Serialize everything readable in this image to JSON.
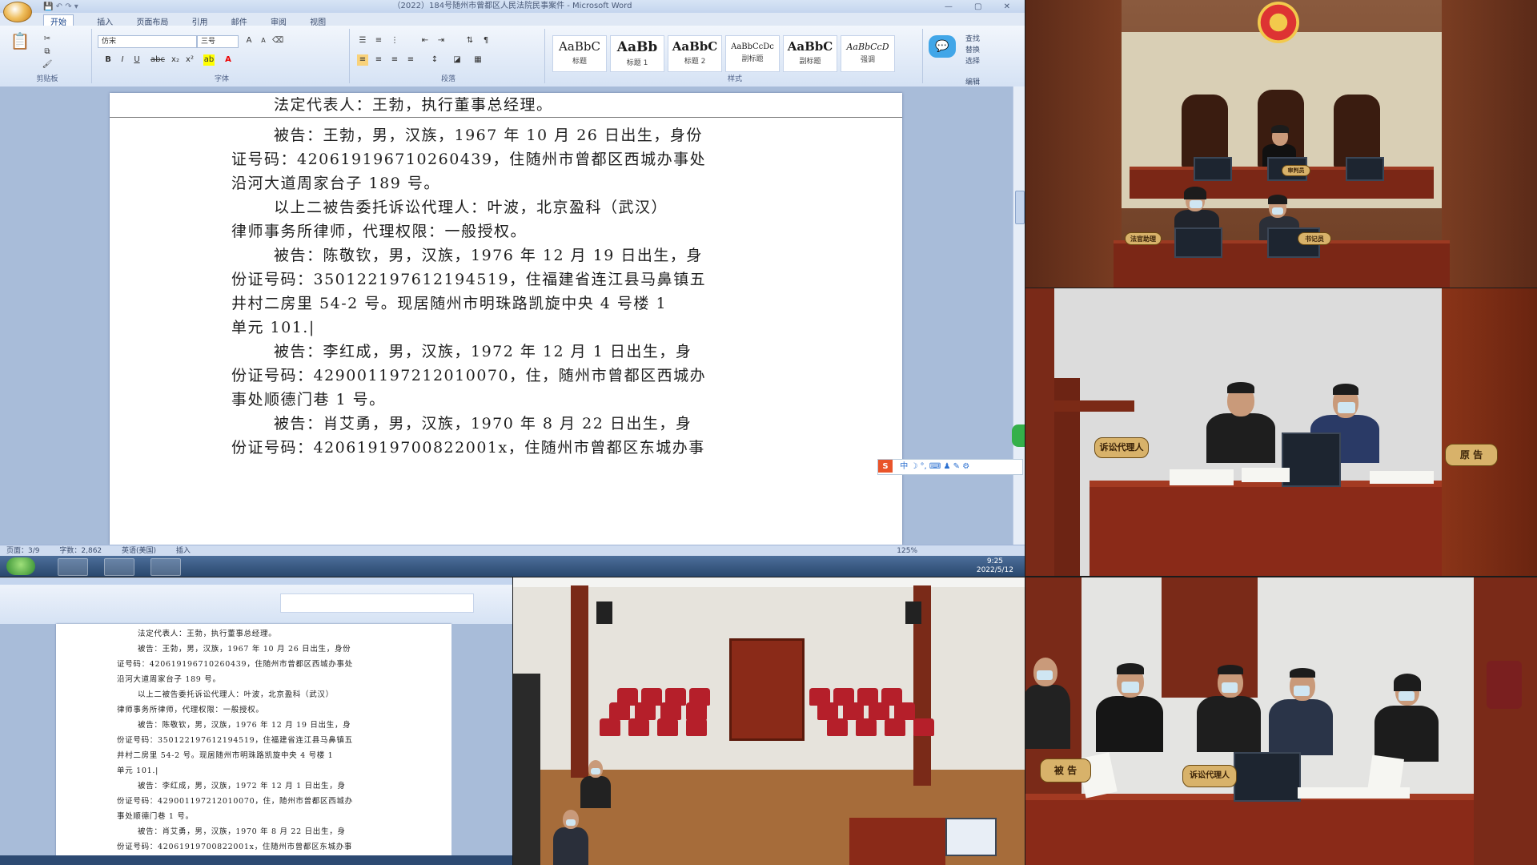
{
  "word": {
    "title_bar": "（2022）184号随州市曾都区人民法院民事案件    - Microsoft Word",
    "tabs": [
      "开始",
      "插入",
      "页面布局",
      "引用",
      "邮件",
      "审阅",
      "视图"
    ],
    "font_name": "仿宋",
    "font_size": "三号",
    "styles": [
      {
        "sample": "AaBbC",
        "name": "标题"
      },
      {
        "sample": "AaBb",
        "name": "标题 1"
      },
      {
        "sample": "AaBbC",
        "name": "标题 2"
      },
      {
        "sample": "AaBbCcDc",
        "name": "副标题"
      },
      {
        "sample": "AaBbC",
        "name": "副标题"
      },
      {
        "sample": "AaBbCcD",
        "name": "强调"
      }
    ],
    "group_labels": [
      "剪贴板",
      "字体",
      "段落",
      "样式",
      "编辑"
    ],
    "edit_group": [
      "查找",
      "替换",
      "选择"
    ],
    "doc_lines": [
      {
        "text": "法定代表人：王勃，执行董事总经理。",
        "indent": true
      },
      {
        "text": "被告：王勃，男，汉族，1967 年 10 月 26 日出生，身份",
        "indent": true
      },
      {
        "text": "证号码：420619196710260439，住随州市曾都区西城办事处",
        "indent": false
      },
      {
        "text": "沿河大道周家台子 189 号。",
        "indent": false
      },
      {
        "text": "以上二被告委托诉讼代理人：叶波，北京盈科（武汉）",
        "indent": true
      },
      {
        "text": "律师事务所律师，代理权限：一般授权。",
        "indent": false
      },
      {
        "text": "被告：陈敬钦，男，汉族，1976 年 12 月 19 日出生，身",
        "indent": true
      },
      {
        "text": "份证号码：350122197612194519，住福建省连江县马鼻镇五",
        "indent": false
      },
      {
        "text": "井村二房里 54-2 号。现居随州市明珠路凯旋中央 4 号楼 1",
        "indent": false
      },
      {
        "text": "单元 101.|",
        "indent": false
      },
      {
        "text": "被告：李红成，男，汉族，1972 年 12 月 1 日出生，身",
        "indent": true
      },
      {
        "text": "份证号码：429001197212010070，住，随州市曾都区西城办",
        "indent": false
      },
      {
        "text": "事处顺德门巷 1 号。",
        "indent": false
      },
      {
        "text": "被告：肖艾勇，男，汉族，1970 年 8 月 22 日出生，身",
        "indent": true
      },
      {
        "text": "份证号码：42061919700822001x，住随州市曾都区东城办事",
        "indent": false
      }
    ],
    "status": {
      "page": "页面：3/9",
      "words": "字数：2,862",
      "lang": "英语(美国)",
      "mode": "插入",
      "zoom": "125%"
    },
    "ime_label": "中",
    "clock": {
      "time": "9:25",
      "date": "2022/5/12"
    }
  },
  "cams": {
    "bench": {
      "role_tags": [
        "审判员",
        "法官助理",
        "书记员"
      ]
    },
    "plaintiff": {
      "role_tags": [
        "诉讼代理人",
        "原 告"
      ]
    },
    "defendant": {
      "role_tags": [
        "被 告",
        "诉讼代理人"
      ]
    }
  },
  "colors": {
    "word_blue": "#dfe8f5",
    "court_red": "#b51f2a",
    "wood": "#7a2a18",
    "sign_gold": "#d8b26a"
  }
}
